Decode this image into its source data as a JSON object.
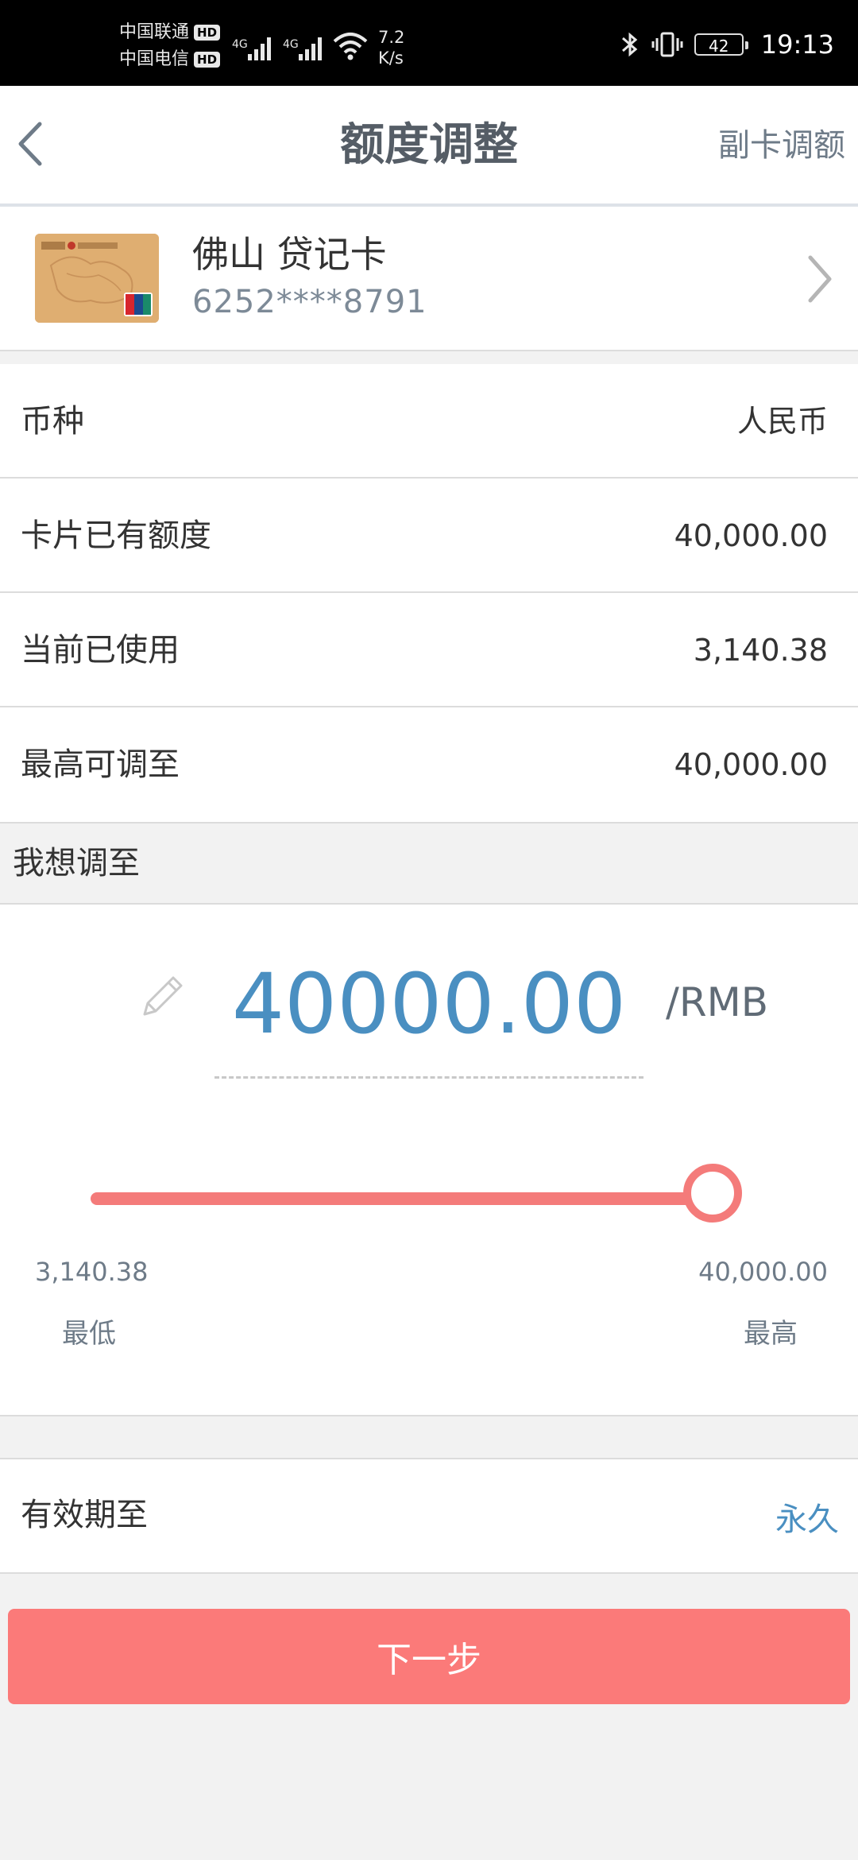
{
  "status_bar": {
    "carrier1": "中国联通",
    "carrier2": "中国电信",
    "hd_badge": "HD",
    "net_speed_value": "7.2",
    "net_speed_unit": "K/s",
    "battery": "42",
    "time": "19:13"
  },
  "nav": {
    "title": "额度调整",
    "right_label": "副卡调额"
  },
  "card": {
    "name": "佛山 贷记卡",
    "number": "6252****8791"
  },
  "info_rows": [
    {
      "label": "币种",
      "value": "人民币"
    },
    {
      "label": "卡片已有额度",
      "value": "40,000.00"
    },
    {
      "label": "当前已使用",
      "value": "3,140.38"
    },
    {
      "label": "最高可调至",
      "value": "40,000.00"
    }
  ],
  "target": {
    "section_label": "我想调至",
    "amount": "40000.00",
    "unit": "/RMB",
    "slider": {
      "min_value": "3,140.38",
      "max_value": "40,000.00",
      "min_label": "最低",
      "max_label": "最高",
      "current_fraction": 1.0
    }
  },
  "validity": {
    "label": "有效期至",
    "value": "永久"
  },
  "next_button": {
    "label": "下一步"
  },
  "colors": {
    "accent_red": "#f47b7a",
    "accent_blue": "#4a8fc1",
    "button_red": "#fb7a79"
  }
}
